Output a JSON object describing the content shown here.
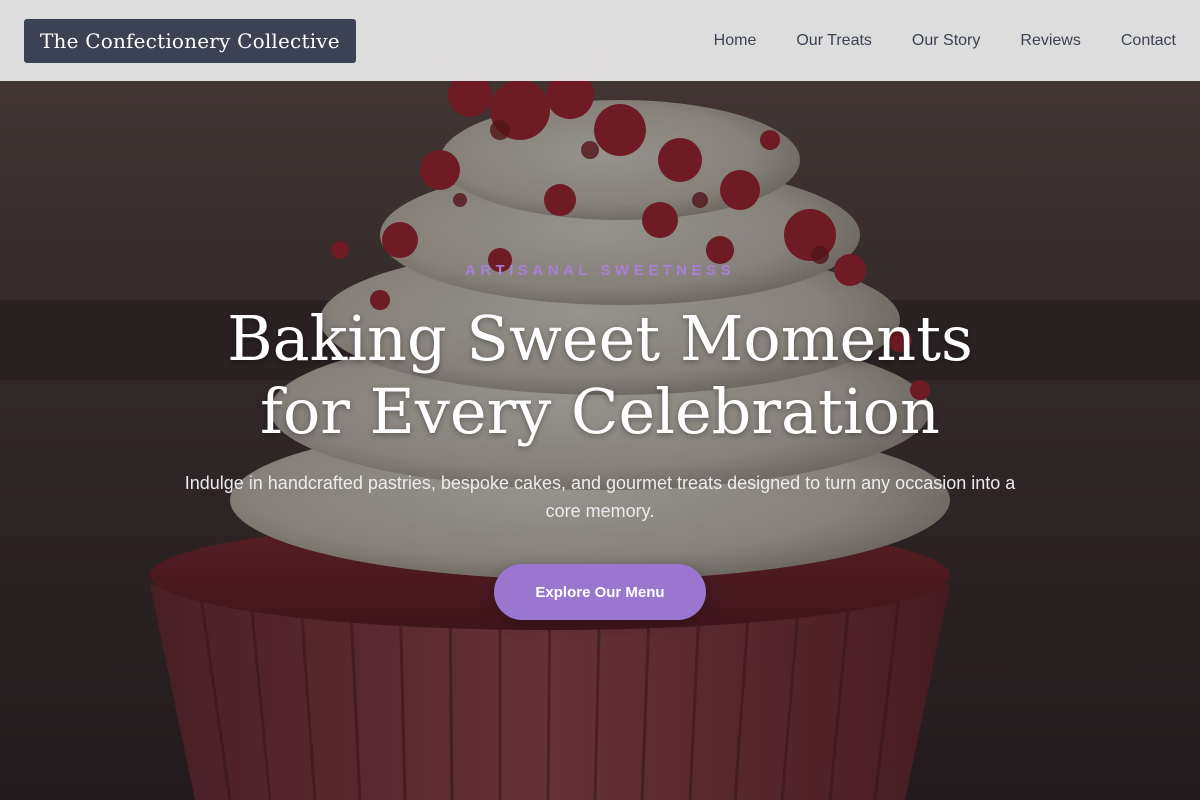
{
  "brand": {
    "name": "The Confectionery Collective"
  },
  "nav": {
    "links": [
      "Home",
      "Our Treats",
      "Our Story",
      "Reviews",
      "Contact"
    ]
  },
  "hero": {
    "eyebrow": "ARTISANAL SWEETNESS",
    "headline_line1": "Baking Sweet Moments",
    "headline_line2": "for Every Celebration",
    "subtitle": "Indulge in handcrafted pastries, bespoke cakes, and gourmet treats designed to turn any occasion into a core memory.",
    "cta_label": "Explore Our Menu",
    "background_image": "red-velvet-cupcake-photo"
  },
  "colors": {
    "accent": "#9a76cf",
    "eyebrow": "#a880d6",
    "brand_bg": "#3a4253",
    "nav_text": "#3a4253"
  }
}
